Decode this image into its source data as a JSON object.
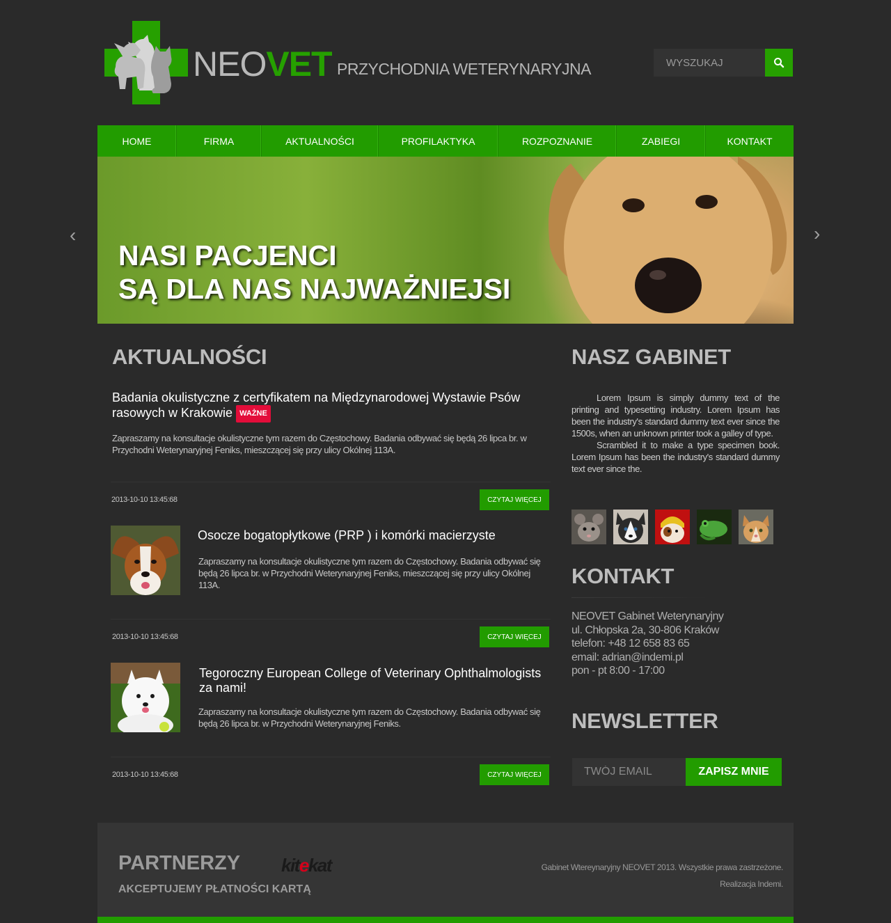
{
  "header": {
    "brand_neo": "NEO",
    "brand_vet": "VET",
    "tagline": "PRZYCHODNIA WETERYNARYJNA",
    "search_placeholder": "WYSZUKAJ"
  },
  "nav": {
    "items": [
      {
        "label": "HOME"
      },
      {
        "label": "FIRMA"
      },
      {
        "label": "AKTUALNOŚCI"
      },
      {
        "label": "PROFILAKTYKA"
      },
      {
        "label": "ROZPOZNANIE"
      },
      {
        "label": "ZABIEGI"
      },
      {
        "label": "KONTAKT"
      }
    ]
  },
  "hero": {
    "line1": "NASI PACJENCI",
    "line2": "SĄ DLA NAS NAJWAŻNIEJSI",
    "prev": "‹",
    "next": "›"
  },
  "news": {
    "heading": "AKTUALNOŚCI",
    "items": [
      {
        "title": "Badania okulistyczne z certyfikatem na Międzynarodowej Wystawie Psów rasowych w Krakowie",
        "badge": "WAŻNE",
        "text": "Zapraszamy na konsultacje okulistyczne tym razem do Częstochowy. Badania odbywać się będą 26  lipca br. w Przychodni Weterynaryjnej Feniks, mieszczącej się przy ulicy Okólnej 113A.",
        "date": "2013-10-10 13:45:68",
        "more": "CZYTAJ WIĘCEJ"
      },
      {
        "title": "Osocze bogatopłytkowe (PRP ) i komórki macierzyste",
        "text": "Zapraszamy na konsultacje okulistyczne tym razem do Częstochowy. Badania odbywać się będą 26  lipca br. w Przychodni Weterynaryjnej Feniks, mieszczącej się przy ulicy Okólnej 113A.",
        "date": "2013-10-10 13:45:68",
        "more": "CZYTAJ WIĘCEJ"
      },
      {
        "title": "Tegoroczny European College of Veterinary Ophthalmologists za nami!",
        "text": "Zapraszamy na konsultacje okulistyczne tym razem do Częstochowy. Badania odbywać się będą 26  lipca br. w Przychodni Weterynaryjnej Feniks.",
        "date": "2013-10-10 13:45:68",
        "more": "CZYTAJ WIĘCEJ"
      }
    ]
  },
  "sidebar": {
    "about_heading": "NASZ GABINET",
    "about_p1": "Lorem Ipsum is simply dummy text of the printing and typesetting industry. Lorem Ipsum has been the industry's standard dummy text ever since the 1500s, when an unknown printer took a galley of type.",
    "about_p2": "Scrambled it to make a type specimen book. Lorem Ipsum has been the industry's standard dummy text ever since the.",
    "contact_heading": "KONTAKT",
    "contact_lines": [
      "NEOVET Gabinet Weterynaryjny",
      "ul. Chłopska 2a, 30-806 Kraków",
      "telefon: +48 12 658 83 65",
      "email: adrian@indemi.pl",
      "pon - pt 8:00 - 17:00"
    ],
    "newsletter_heading": "NEWSLETTER",
    "newsletter_placeholder": "TWÓJ EMAIL",
    "newsletter_button": "ZAPISZ MNIE"
  },
  "footer": {
    "partners_heading": "PARTNERZY",
    "partner_logo_a": "kit",
    "partner_logo_e": "e",
    "partner_logo_b": "kat",
    "cards_text": "AKCEPTUJEMY PŁATNOŚCI KARTĄ",
    "copyright": "Gabinet Wtereynaryjny NEOVET 2013. Wszystkie prawa zastrzeżone.",
    "credit": "Realizacja Indemi."
  },
  "colors": {
    "accent_green": "#229c00",
    "background": "#2a2a2a",
    "badge_red": "#e30d3a"
  }
}
